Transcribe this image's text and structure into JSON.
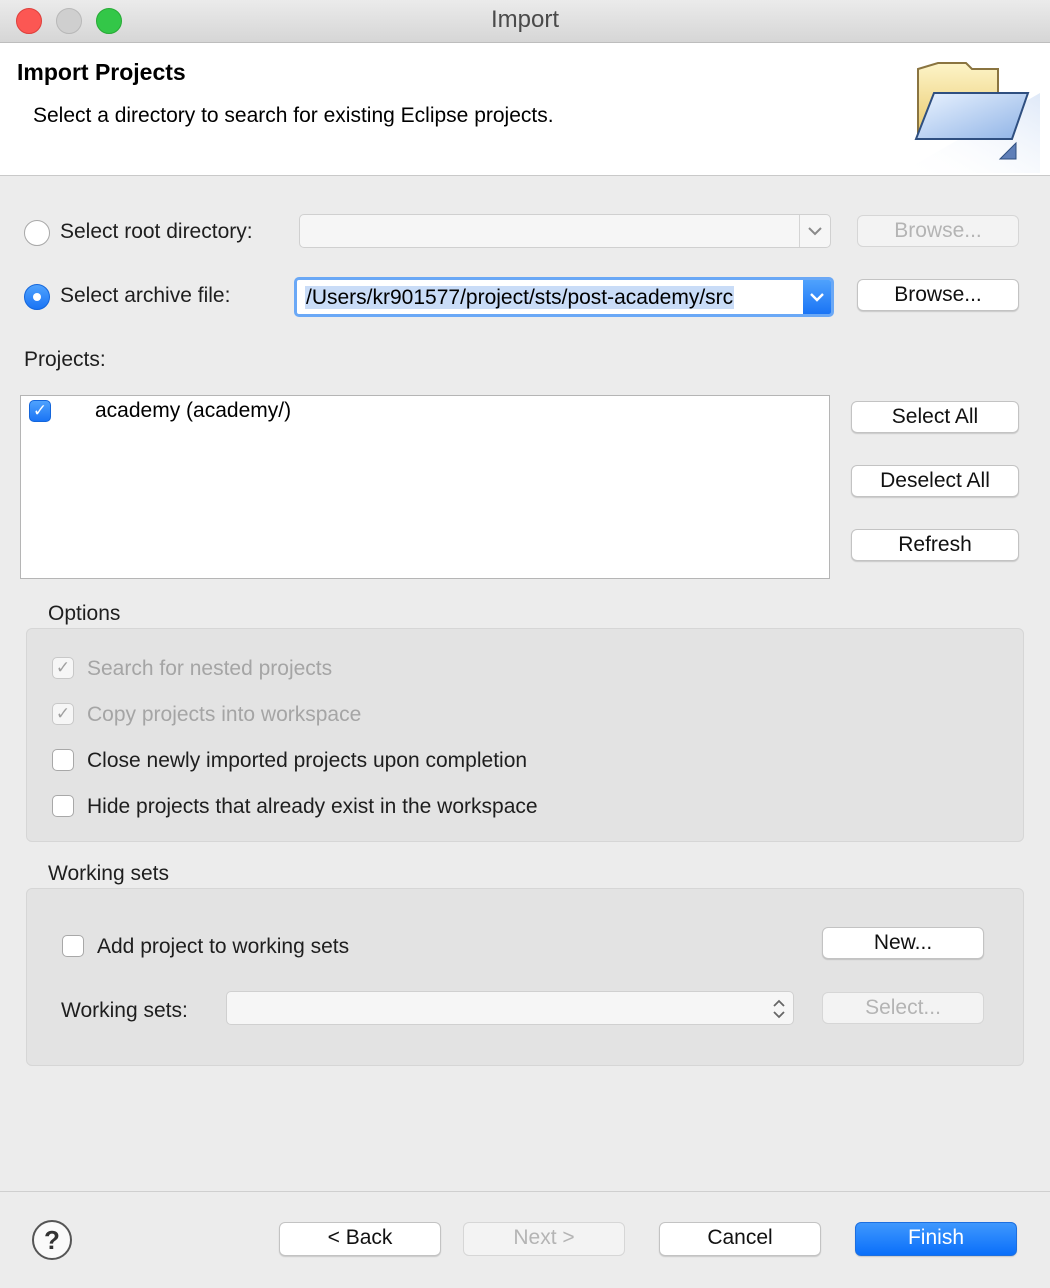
{
  "window": {
    "title": "Import"
  },
  "header": {
    "title": "Import Projects",
    "description": "Select a directory to search for existing Eclipse projects."
  },
  "source": {
    "root_dir_label": "Select root directory:",
    "root_dir_value": "",
    "root_browse_label": "Browse...",
    "archive_label": "Select archive file:",
    "archive_value": "/Users/kr901577/project/sts/post-academy/src",
    "archive_browse_label": "Browse...",
    "selected_option": "archive"
  },
  "projects": {
    "label": "Projects:",
    "items": [
      {
        "label": "academy (academy/)",
        "checked": true
      }
    ],
    "select_all_label": "Select All",
    "deselect_all_label": "Deselect All",
    "refresh_label": "Refresh"
  },
  "options": {
    "title": "Options",
    "items": [
      {
        "label": "Search for nested projects",
        "checked": true,
        "enabled": false
      },
      {
        "label": "Copy projects into workspace",
        "checked": true,
        "enabled": false
      },
      {
        "label": "Close newly imported projects upon completion",
        "checked": false,
        "enabled": true
      },
      {
        "label": "Hide projects that already exist in the workspace",
        "checked": false,
        "enabled": true
      }
    ]
  },
  "working_sets": {
    "title": "Working sets",
    "add_label": "Add project to working sets",
    "add_checked": false,
    "new_label": "New...",
    "sets_label": "Working sets:",
    "sets_value": "",
    "select_label": "Select..."
  },
  "footer": {
    "help_label": "?",
    "back_label": "< Back",
    "next_label": "Next >",
    "cancel_label": "Cancel",
    "finish_label": "Finish"
  },
  "colors": {
    "accent": "#1a74f5",
    "window_bg": "#ececec",
    "close": "#fc5753",
    "maximize": "#33c748"
  }
}
